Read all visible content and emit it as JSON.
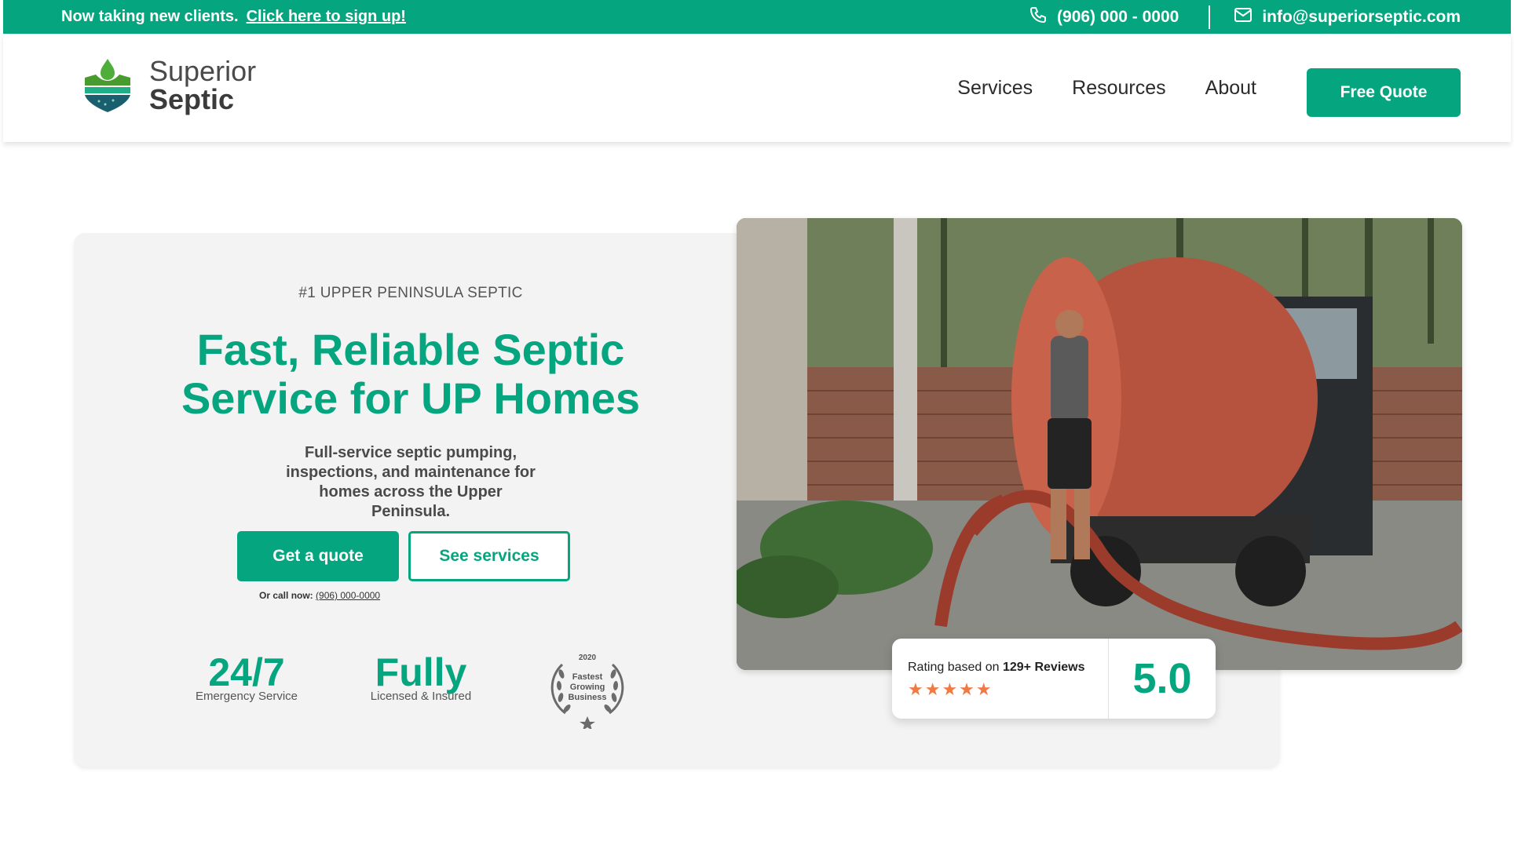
{
  "topbar": {
    "announce": "Now taking new clients.",
    "signup_link": "Click here to sign up!",
    "phone": "(906) 000 - 0000",
    "email": "info@superiorseptic.com"
  },
  "header": {
    "logo_line1": "Superior",
    "logo_line2": "Septic",
    "nav": [
      "Services",
      "Resources",
      "About"
    ],
    "cta": "Free Quote"
  },
  "hero": {
    "eyebrow": "#1 UPPER PENINSULA SEPTIC",
    "headline_line1": "Fast, Reliable Septic",
    "headline_line2": "Service for UP Homes",
    "subtitle": "Full-service septic pumping, inspections, and maintenance for homes across the Upper Peninsula.",
    "primary_button": "Get a quote",
    "secondary_button": "See services",
    "callnow_label": "Or call now:",
    "callnow_number": "(906) 000-0000",
    "stats": [
      {
        "big": "24/7",
        "small": "Emergency Service"
      },
      {
        "big": "Fully",
        "small": "Licensed & Insured"
      }
    ],
    "badge": {
      "year": "2020",
      "line1": "Fastest",
      "line2": "Growing",
      "line3": "Business"
    }
  },
  "rating": {
    "label_prefix": "Rating based on",
    "label_count": "129+ Reviews",
    "stars": "★★★★★",
    "score": "5.0"
  },
  "colors": {
    "brand": "#05a67f",
    "star": "#f07a45"
  }
}
